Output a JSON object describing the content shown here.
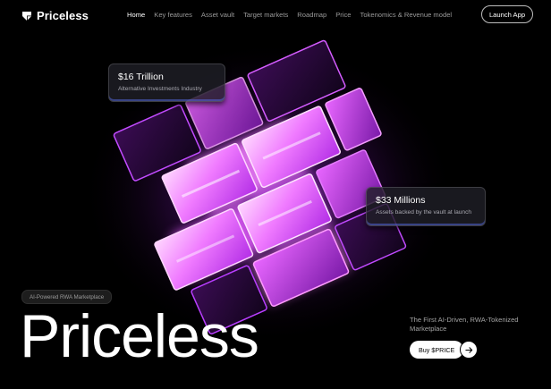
{
  "brand": {
    "name": "Priceless",
    "icon": "priceless-logo-icon"
  },
  "nav": {
    "items": [
      {
        "label": "Home",
        "active": true
      },
      {
        "label": "Key features",
        "active": false
      },
      {
        "label": "Asset vault",
        "active": false
      },
      {
        "label": "Target markets",
        "active": false
      },
      {
        "label": "Roadmap",
        "active": false
      },
      {
        "label": "Price",
        "active": false
      },
      {
        "label": "Tokenomics & Revenue model",
        "active": false
      }
    ]
  },
  "header": {
    "launch_label": "Launch App"
  },
  "stats": [
    {
      "value": "$16 Trillion",
      "label": "Alternative Investments Industry"
    },
    {
      "value": "$33 Millions",
      "label": "Assets backed by the vault at launch"
    }
  ],
  "hero": {
    "tag": "AI-Powered RWA Marketplace",
    "title": "Priceless",
    "tagline": "The First AI-Driven, RWA-Tokenized Marketplace",
    "cta_label": "Buy $PRICE",
    "cta_icon": "arrow-right-icon"
  },
  "colors": {
    "background": "#000000",
    "glow": "#e84cff",
    "glow_core": "#ffc9ff",
    "card_accent": "#5f78ff"
  }
}
